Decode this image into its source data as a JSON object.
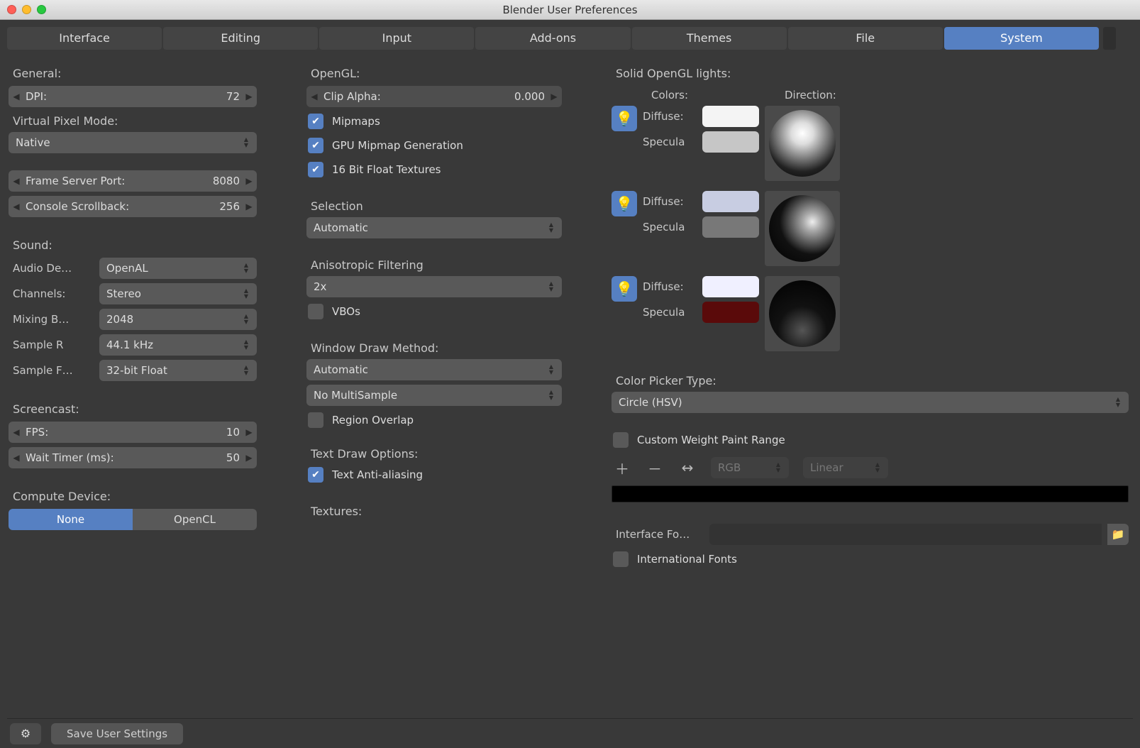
{
  "window": {
    "title": "Blender User Preferences"
  },
  "tabs": {
    "items": [
      "Interface",
      "Editing",
      "Input",
      "Add-ons",
      "Themes",
      "File",
      "System"
    ],
    "active": "System"
  },
  "general": {
    "heading": "General:",
    "dpi_label": "DPI:",
    "dpi_value": "72",
    "vpm_heading": "Virtual Pixel Mode:",
    "vpm_value": "Native",
    "frame_port_label": "Frame Server Port:",
    "frame_port_value": "8080",
    "console_label": "Console Scrollback:",
    "console_value": "256"
  },
  "sound": {
    "heading": "Sound:",
    "audio_device_label": "Audio De…",
    "audio_device_value": "OpenAL",
    "channels_label": "Channels:",
    "channels_value": "Stereo",
    "mixing_label": "Mixing B…",
    "mixing_value": "2048",
    "sample_rate_label": "Sample R",
    "sample_rate_value": "44.1 kHz",
    "sample_fmt_label": "Sample F…",
    "sample_fmt_value": "32-bit Float"
  },
  "screencast": {
    "heading": "Screencast:",
    "fps_label": "FPS:",
    "fps_value": "10",
    "wait_label": "Wait Timer (ms):",
    "wait_value": "50"
  },
  "compute": {
    "heading": "Compute Device:",
    "none": "None",
    "opencl": "OpenCL"
  },
  "opengl": {
    "heading": "OpenGL:",
    "clip_label": "Clip Alpha:",
    "clip_value": "0.000",
    "mipmaps": "Mipmaps",
    "gpu_mipmap": "GPU Mipmap Generation",
    "float16": "16 Bit Float Textures",
    "selection_heading": "Selection",
    "selection_value": "Automatic",
    "aniso_heading": "Anisotropic Filtering",
    "aniso_value": "2x",
    "vbos": "VBOs",
    "wdm_heading": "Window Draw Method:",
    "wdm_value": "Automatic",
    "multisample_value": "No MultiSample",
    "region_overlap": "Region Overlap",
    "text_draw_heading": "Text Draw Options:",
    "text_aa": "Text Anti-aliasing",
    "textures_heading": "Textures:"
  },
  "lights": {
    "heading": "Solid OpenGL lights:",
    "colors_heading": "Colors:",
    "direction_heading": "Direction:",
    "diffuse": "Diffuse:",
    "specular": "Specula",
    "sw": {
      "l1_diff": "#f4f4f4",
      "l1_spec": "#c6c6c6",
      "l2_diff": "#c8cde2",
      "l2_spec": "#787878",
      "l3_diff": "#f0f0ff",
      "l3_spec": "#5a0a0a"
    }
  },
  "color_picker": {
    "heading": "Color Picker Type:",
    "value": "Circle (HSV)"
  },
  "weight_paint": {
    "label": "Custom Weight Paint Range",
    "rgb": "RGB",
    "linear": "Linear"
  },
  "interface_font": {
    "label": "Interface Fo…"
  },
  "intl_fonts": {
    "label": "International Fonts"
  },
  "bottom": {
    "save": "Save User Settings"
  }
}
